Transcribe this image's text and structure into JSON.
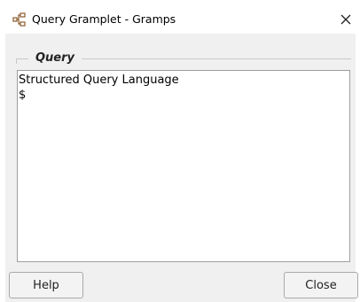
{
  "window": {
    "title": "Query Gramplet - Gramps",
    "icon": "gramps-tree-icon",
    "close_icon": "close-icon"
  },
  "frame": {
    "label": "Query"
  },
  "textview": {
    "content": "Structured Query Language\n$"
  },
  "buttons": {
    "help": "Help",
    "close": "Close"
  }
}
